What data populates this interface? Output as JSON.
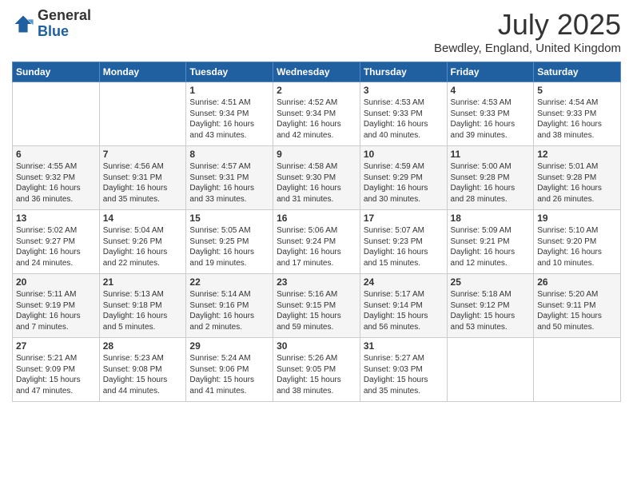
{
  "logo": {
    "general": "General",
    "blue": "Blue"
  },
  "title": "July 2025",
  "subtitle": "Bewdley, England, United Kingdom",
  "days_of_week": [
    "Sunday",
    "Monday",
    "Tuesday",
    "Wednesday",
    "Thursday",
    "Friday",
    "Saturday"
  ],
  "weeks": [
    [
      {
        "day": "",
        "detail": ""
      },
      {
        "day": "",
        "detail": ""
      },
      {
        "day": "1",
        "detail": "Sunrise: 4:51 AM\nSunset: 9:34 PM\nDaylight: 16 hours and 43 minutes."
      },
      {
        "day": "2",
        "detail": "Sunrise: 4:52 AM\nSunset: 9:34 PM\nDaylight: 16 hours and 42 minutes."
      },
      {
        "day": "3",
        "detail": "Sunrise: 4:53 AM\nSunset: 9:33 PM\nDaylight: 16 hours and 40 minutes."
      },
      {
        "day": "4",
        "detail": "Sunrise: 4:53 AM\nSunset: 9:33 PM\nDaylight: 16 hours and 39 minutes."
      },
      {
        "day": "5",
        "detail": "Sunrise: 4:54 AM\nSunset: 9:33 PM\nDaylight: 16 hours and 38 minutes."
      }
    ],
    [
      {
        "day": "6",
        "detail": "Sunrise: 4:55 AM\nSunset: 9:32 PM\nDaylight: 16 hours and 36 minutes."
      },
      {
        "day": "7",
        "detail": "Sunrise: 4:56 AM\nSunset: 9:31 PM\nDaylight: 16 hours and 35 minutes."
      },
      {
        "day": "8",
        "detail": "Sunrise: 4:57 AM\nSunset: 9:31 PM\nDaylight: 16 hours and 33 minutes."
      },
      {
        "day": "9",
        "detail": "Sunrise: 4:58 AM\nSunset: 9:30 PM\nDaylight: 16 hours and 31 minutes."
      },
      {
        "day": "10",
        "detail": "Sunrise: 4:59 AM\nSunset: 9:29 PM\nDaylight: 16 hours and 30 minutes."
      },
      {
        "day": "11",
        "detail": "Sunrise: 5:00 AM\nSunset: 9:28 PM\nDaylight: 16 hours and 28 minutes."
      },
      {
        "day": "12",
        "detail": "Sunrise: 5:01 AM\nSunset: 9:28 PM\nDaylight: 16 hours and 26 minutes."
      }
    ],
    [
      {
        "day": "13",
        "detail": "Sunrise: 5:02 AM\nSunset: 9:27 PM\nDaylight: 16 hours and 24 minutes."
      },
      {
        "day": "14",
        "detail": "Sunrise: 5:04 AM\nSunset: 9:26 PM\nDaylight: 16 hours and 22 minutes."
      },
      {
        "day": "15",
        "detail": "Sunrise: 5:05 AM\nSunset: 9:25 PM\nDaylight: 16 hours and 19 minutes."
      },
      {
        "day": "16",
        "detail": "Sunrise: 5:06 AM\nSunset: 9:24 PM\nDaylight: 16 hours and 17 minutes."
      },
      {
        "day": "17",
        "detail": "Sunrise: 5:07 AM\nSunset: 9:23 PM\nDaylight: 16 hours and 15 minutes."
      },
      {
        "day": "18",
        "detail": "Sunrise: 5:09 AM\nSunset: 9:21 PM\nDaylight: 16 hours and 12 minutes."
      },
      {
        "day": "19",
        "detail": "Sunrise: 5:10 AM\nSunset: 9:20 PM\nDaylight: 16 hours and 10 minutes."
      }
    ],
    [
      {
        "day": "20",
        "detail": "Sunrise: 5:11 AM\nSunset: 9:19 PM\nDaylight: 16 hours and 7 minutes."
      },
      {
        "day": "21",
        "detail": "Sunrise: 5:13 AM\nSunset: 9:18 PM\nDaylight: 16 hours and 5 minutes."
      },
      {
        "day": "22",
        "detail": "Sunrise: 5:14 AM\nSunset: 9:16 PM\nDaylight: 16 hours and 2 minutes."
      },
      {
        "day": "23",
        "detail": "Sunrise: 5:16 AM\nSunset: 9:15 PM\nDaylight: 15 hours and 59 minutes."
      },
      {
        "day": "24",
        "detail": "Sunrise: 5:17 AM\nSunset: 9:14 PM\nDaylight: 15 hours and 56 minutes."
      },
      {
        "day": "25",
        "detail": "Sunrise: 5:18 AM\nSunset: 9:12 PM\nDaylight: 15 hours and 53 minutes."
      },
      {
        "day": "26",
        "detail": "Sunrise: 5:20 AM\nSunset: 9:11 PM\nDaylight: 15 hours and 50 minutes."
      }
    ],
    [
      {
        "day": "27",
        "detail": "Sunrise: 5:21 AM\nSunset: 9:09 PM\nDaylight: 15 hours and 47 minutes."
      },
      {
        "day": "28",
        "detail": "Sunrise: 5:23 AM\nSunset: 9:08 PM\nDaylight: 15 hours and 44 minutes."
      },
      {
        "day": "29",
        "detail": "Sunrise: 5:24 AM\nSunset: 9:06 PM\nDaylight: 15 hours and 41 minutes."
      },
      {
        "day": "30",
        "detail": "Sunrise: 5:26 AM\nSunset: 9:05 PM\nDaylight: 15 hours and 38 minutes."
      },
      {
        "day": "31",
        "detail": "Sunrise: 5:27 AM\nSunset: 9:03 PM\nDaylight: 15 hours and 35 minutes."
      },
      {
        "day": "",
        "detail": ""
      },
      {
        "day": "",
        "detail": ""
      }
    ]
  ]
}
